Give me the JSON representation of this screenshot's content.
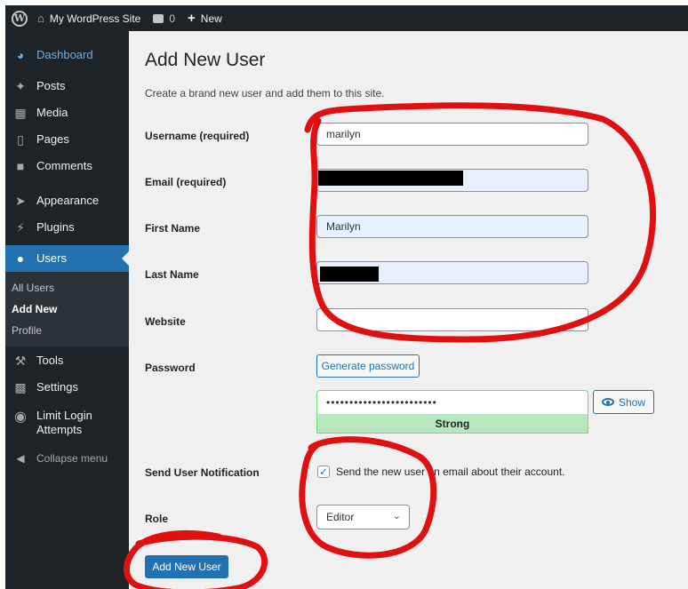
{
  "adminbar": {
    "logo": "W",
    "site_name": "My WordPress Site",
    "site_icon": "home-icon",
    "comments_icon": "comment-bubble-icon",
    "comments_count": "0",
    "new_label": "New",
    "new_icon": "plus-icon"
  },
  "sidebar": {
    "dashboard": "Dashboard",
    "posts": "Posts",
    "media": "Media",
    "pages": "Pages",
    "comments": "Comments",
    "appearance": "Appearance",
    "plugins": "Plugins",
    "users": "Users",
    "submenu": {
      "all_users": "All Users",
      "add_new": "Add New",
      "profile": "Profile"
    },
    "tools": "Tools",
    "settings": "Settings",
    "limit_login": "Limit Login Attempts",
    "collapse": "Collapse menu"
  },
  "form": {
    "title": "Add New User",
    "description": "Create a brand new user and add them to this site.",
    "username_label": "Username (required)",
    "username_value": "marilyn",
    "email_label": "Email (required)",
    "first_name_label": "First Name",
    "first_name_value": "Marilyn",
    "last_name_label": "Last Name",
    "website_label": "Website",
    "website_value": "",
    "password_label": "Password",
    "generate_password": "Generate password",
    "password_mask": "••••••••••••••••••••••••",
    "show_label": "Show",
    "strength": "Strong",
    "notification_label": "Send User Notification",
    "notification_text": "Send the new user an email about their account.",
    "notification_checked": true,
    "role_label": "Role",
    "role_value": "Editor",
    "submit": "Add New User"
  },
  "colors": {
    "admin_bar": "#1d2327",
    "accent": "#2271b1",
    "strength_bg": "#b8e6bf",
    "annotation": "#e01010"
  }
}
